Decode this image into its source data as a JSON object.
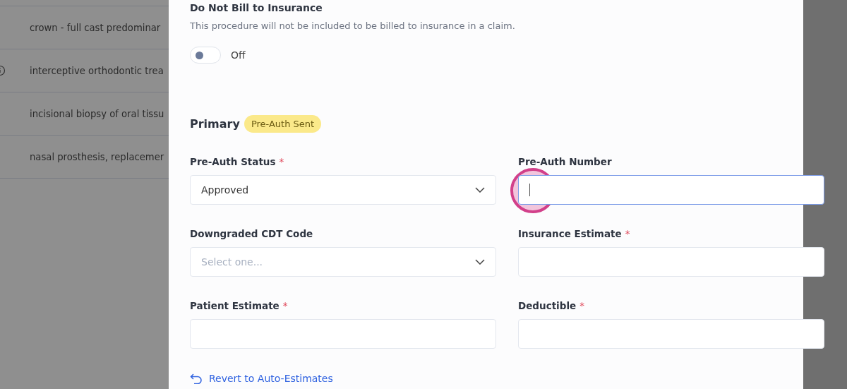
{
  "background_list": {
    "rows": [
      {
        "text": "crown - full cast predominar",
        "info": false
      },
      {
        "text": "interceptive orthodontic trea",
        "info": true
      },
      {
        "text": "incisional biopsy of oral tissu",
        "info": false
      },
      {
        "text": "nasal prosthesis, replacemer",
        "info": false
      }
    ]
  },
  "panel": {
    "do_not_bill": {
      "title": "Do Not Bill to Insurance",
      "description": "This procedure will not be included to be billed to insurance in a claim.",
      "on": false,
      "state_label": "Off"
    },
    "section": {
      "title": "Primary",
      "badge": "Pre-Auth Sent"
    },
    "fields": [
      {
        "kind": "select",
        "label": "Pre-Auth Status",
        "required_mark": "*",
        "value": "Approved",
        "focused": false
      },
      {
        "kind": "text",
        "label": "Pre-Auth Number",
        "focused": true
      },
      {
        "kind": "select",
        "label": "Downgraded CDT Code",
        "placeholder": "Select one...",
        "focused": false
      },
      {
        "kind": "text",
        "label": "Insurance Estimate",
        "required_mark": "*",
        "focused": false
      },
      {
        "kind": "text",
        "label": "Patient Estimate",
        "required_mark": "*",
        "focused": false
      },
      {
        "kind": "text",
        "label": "Deductible",
        "required_mark": "*",
        "focused": false
      }
    ],
    "revert_link": "Revert to Auto-Estimates"
  }
}
